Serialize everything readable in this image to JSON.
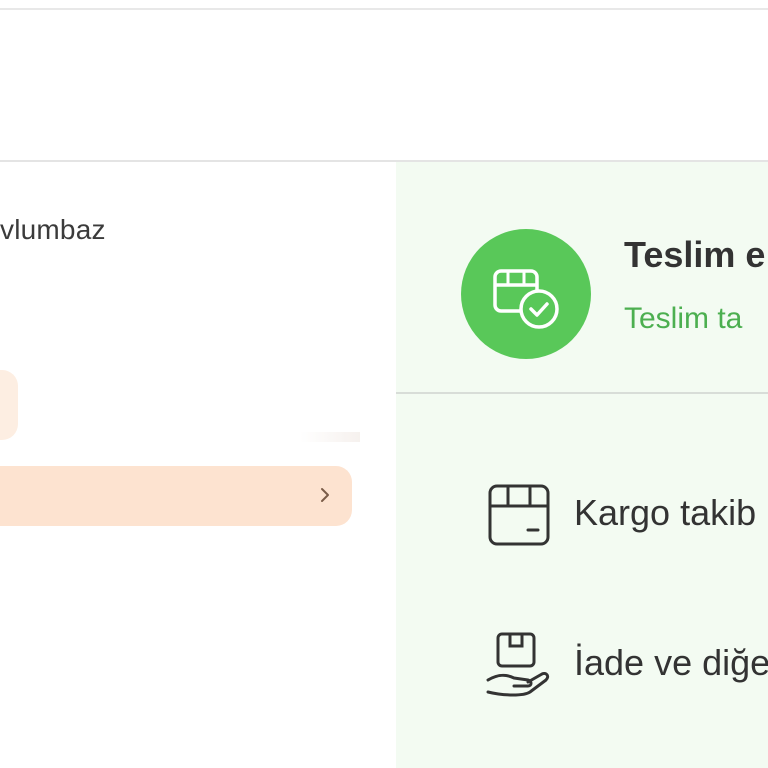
{
  "seller": {
    "name": "vlumbaz"
  },
  "order_status": {
    "title": "Teslim e",
    "subtitle": "Teslim ta",
    "color": "#59c859"
  },
  "actions": [
    {
      "label": "Kargo takib",
      "icon": "cargo-box-icon"
    },
    {
      "label": "İade ve diğe",
      "icon": "return-hand-icon"
    }
  ],
  "colors": {
    "accent_orange": "#fde3d0",
    "status_green": "#59c859",
    "panel_green": "#f3fbf2"
  }
}
